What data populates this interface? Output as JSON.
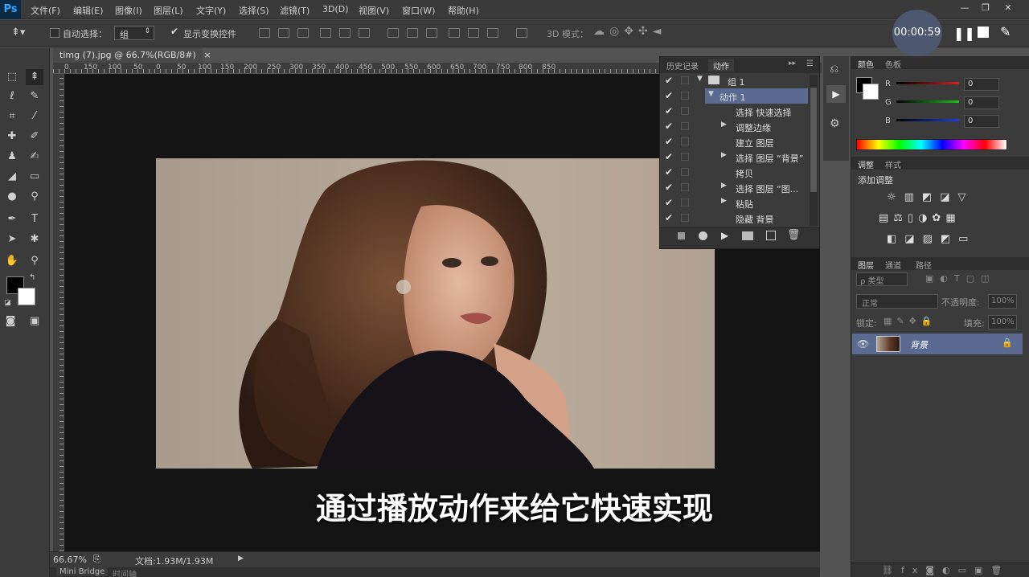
{
  "app": {
    "logo": "Ps"
  },
  "menu": [
    "文件(F)",
    "编辑(E)",
    "图像(I)",
    "图层(L)",
    "文字(Y)",
    "选择(S)",
    "滤镜(T)",
    "3D(D)",
    "视图(V)",
    "窗口(W)",
    "帮助(H)"
  ],
  "options": {
    "auto_select_label": "自动选择：",
    "auto_select_value": "组",
    "show_transform_label": "显示变换控件",
    "mode3d_label": "3D 模式："
  },
  "recorder": {
    "time": "00:00:59"
  },
  "document": {
    "tab_title": "timg (7).jpg @ 66.7%(RGB/8#)",
    "ruler_labels": [
      "0",
      "150",
      "100",
      "50",
      "0",
      "50",
      "100",
      "150",
      "200",
      "250",
      "300",
      "350",
      "400",
      "450",
      "500",
      "550",
      "600",
      "650",
      "700",
      "750",
      "800",
      "850"
    ],
    "zoom": "66.67%",
    "doc_size": "文档:1.93M/1.93M"
  },
  "subtitle": "通过播放动作来给它快速实现",
  "bottom_tabs": [
    "Mini Bridge",
    "时间轴"
  ],
  "actions_panel": {
    "tabs": [
      "历史记录",
      "动作"
    ],
    "rows": [
      {
        "label": "组 1",
        "level": 0,
        "twisty": "▼",
        "folder": true,
        "selected": false
      },
      {
        "label": "动作 1",
        "level": 1,
        "twisty": "▼",
        "folder": false,
        "selected": true
      },
      {
        "label": "选择 快速选择",
        "level": 2,
        "twisty": "",
        "folder": false,
        "selected": false
      },
      {
        "label": "调整边缘",
        "level": 2,
        "twisty": "▶",
        "folder": false,
        "selected": false
      },
      {
        "label": "建立 图层",
        "level": 2,
        "twisty": "",
        "folder": false,
        "selected": false
      },
      {
        "label": "选择 图层 “背景”",
        "level": 2,
        "twisty": "▶",
        "folder": false,
        "selected": false
      },
      {
        "label": "拷贝",
        "level": 2,
        "twisty": "",
        "folder": false,
        "selected": false
      },
      {
        "label": "选择 图层 “图...",
        "level": 2,
        "twisty": "▶",
        "folder": false,
        "selected": false
      },
      {
        "label": "粘贴",
        "level": 2,
        "twisty": "▶",
        "folder": false,
        "selected": false
      },
      {
        "label": "隐藏 背景",
        "level": 2,
        "twisty": "",
        "folder": false,
        "selected": false
      }
    ]
  },
  "color_panel": {
    "tabs": [
      "颜色",
      "色板"
    ],
    "channels": [
      {
        "name": "R",
        "value": "0",
        "color": "#d02020"
      },
      {
        "name": "G",
        "value": "0",
        "color": "#20c020"
      },
      {
        "name": "B",
        "value": "0",
        "color": "#2040e0"
      }
    ]
  },
  "adjust_panel": {
    "tabs": [
      "调整",
      "样式"
    ],
    "title": "添加调整"
  },
  "layers_panel": {
    "tabs": [
      "图层",
      "通道",
      "路径"
    ],
    "filter_label": "ρ 类型",
    "blend_mode": "正常",
    "opacity_label": "不透明度:",
    "opacity_value": "100%",
    "lock_label": "锁定:",
    "fill_label": "填充:",
    "fill_value": "100%",
    "layer_name": "背景"
  }
}
